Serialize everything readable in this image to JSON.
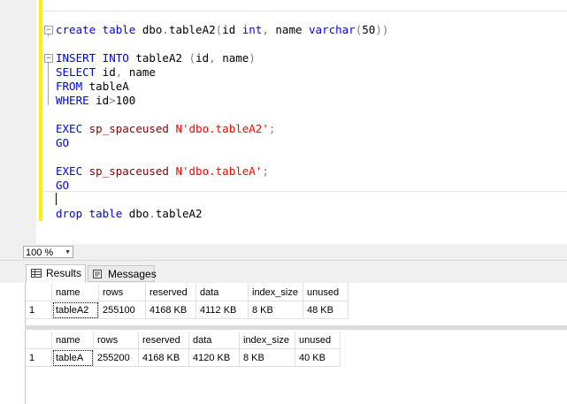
{
  "editor": {
    "lines": [
      [
        {
          "t": "create table ",
          "c": "kw"
        },
        {
          "t": "dbo",
          "c": "txt"
        },
        {
          "t": ".",
          "c": "op"
        },
        {
          "t": "tableA2",
          "c": "txt"
        },
        {
          "t": "(",
          "c": "op"
        },
        {
          "t": "id ",
          "c": "txt"
        },
        {
          "t": "int",
          "c": "kw"
        },
        {
          "t": ", ",
          "c": "op"
        },
        {
          "t": "name ",
          "c": "txt"
        },
        {
          "t": "varchar",
          "c": "kw"
        },
        {
          "t": "(",
          "c": "op"
        },
        {
          "t": "50",
          "c": "txt"
        },
        {
          "t": "))",
          "c": "op"
        }
      ],
      [],
      [
        {
          "t": "INSERT INTO ",
          "c": "kw"
        },
        {
          "t": "tableA2 ",
          "c": "txt"
        },
        {
          "t": "(",
          "c": "op"
        },
        {
          "t": "id",
          "c": "txt"
        },
        {
          "t": ", ",
          "c": "op"
        },
        {
          "t": "name",
          "c": "txt"
        },
        {
          "t": ")",
          "c": "op"
        }
      ],
      [
        {
          "t": "SELECT ",
          "c": "kw"
        },
        {
          "t": "id",
          "c": "txt"
        },
        {
          "t": ", ",
          "c": "op"
        },
        {
          "t": "name",
          "c": "txt"
        }
      ],
      [
        {
          "t": "FROM ",
          "c": "kw"
        },
        {
          "t": "tableA",
          "c": "txt"
        }
      ],
      [
        {
          "t": "WHERE ",
          "c": "kw"
        },
        {
          "t": "id",
          "c": "txt"
        },
        {
          "t": ">",
          "c": "op"
        },
        {
          "t": "100",
          "c": "txt"
        }
      ],
      [],
      [
        {
          "t": "EXEC ",
          "c": "kw"
        },
        {
          "t": "sp_spaceused ",
          "c": "fn"
        },
        {
          "t": "N'dbo.tableA2'",
          "c": "str"
        },
        {
          "t": ";",
          "c": "op"
        }
      ],
      [
        {
          "t": "GO",
          "c": "kw"
        }
      ],
      [],
      [
        {
          "t": "EXEC ",
          "c": "kw"
        },
        {
          "t": "sp_spaceused ",
          "c": "fn"
        },
        {
          "t": "N'dbo.tableA'",
          "c": "str"
        },
        {
          "t": ";",
          "c": "op"
        }
      ],
      [
        {
          "t": "GO",
          "c": "kw"
        }
      ],
      [],
      [
        {
          "t": "drop table ",
          "c": "kw"
        },
        {
          "t": "dbo",
          "c": "txt"
        },
        {
          "t": ".",
          "c": "op"
        },
        {
          "t": "tableA2",
          "c": "txt"
        }
      ]
    ]
  },
  "zoom": {
    "value": "100 %"
  },
  "tabs": {
    "results": "Results",
    "messages": "Messages"
  },
  "grid1": {
    "headers": [
      "name",
      "rows",
      "reserved",
      "data",
      "index_size",
      "unused"
    ],
    "row_number": "1",
    "row": [
      "tableA2",
      "255100",
      "4168 KB",
      "4112 KB",
      "8 KB",
      "48 KB"
    ]
  },
  "grid2": {
    "headers": [
      "name",
      "rows",
      "reserved",
      "data",
      "index_size",
      "unused"
    ],
    "row_number": "1",
    "row": [
      "tableA",
      "255200",
      "4168 KB",
      "4120 KB",
      "8 KB",
      "40 KB"
    ]
  },
  "colors": {
    "keyword": "#0000ff",
    "string": "#ff0000",
    "proc": "#800000",
    "operator": "#808080",
    "change_bar": "#ffef00"
  }
}
